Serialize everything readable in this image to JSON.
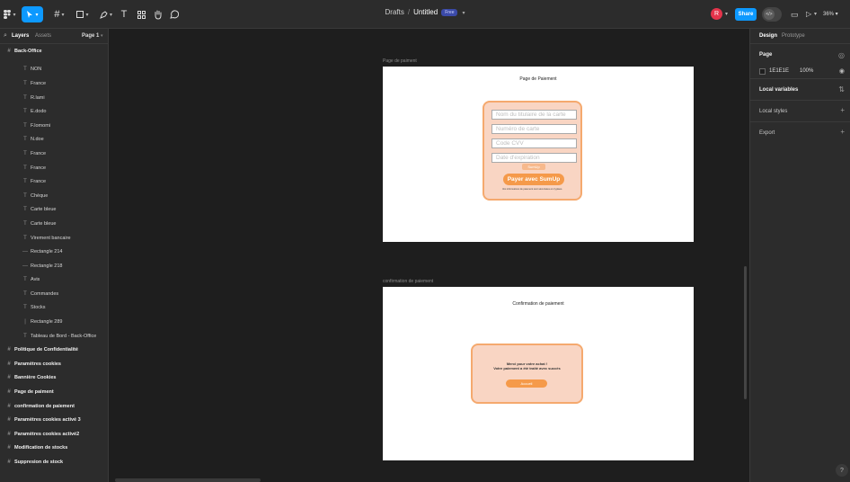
{
  "toolbar": {
    "tools": [
      {
        "name": "main-menu",
        "icon": "figma-logo-icon"
      },
      {
        "name": "move-tool",
        "icon": "cursor-icon"
      },
      {
        "name": "frame-tool",
        "icon": "hash-icon"
      },
      {
        "name": "shape-tool",
        "icon": "rectangle-icon"
      },
      {
        "name": "pen-tool",
        "icon": "pen-icon"
      },
      {
        "name": "text-tool",
        "icon": "text-icon",
        "glyph": "T"
      },
      {
        "name": "resources-tool",
        "icon": "resources-icon"
      },
      {
        "name": "hand-tool",
        "icon": "hand-icon"
      },
      {
        "name": "comment-tool",
        "icon": "comment-icon"
      }
    ],
    "accent": "#0d99ff"
  },
  "header": {
    "folder": "Drafts",
    "separator": "/",
    "file_name": "Untitled",
    "badge": "Free",
    "avatar_initial": "R",
    "share_label": "Share",
    "devmode_label": "</>",
    "zoom": "36%"
  },
  "left_panel": {
    "tab_layers": "Layers",
    "tab_assets": "Assets",
    "page_selector": "Page 1",
    "layers": [
      {
        "kind": "top",
        "label": "Back-Office",
        "icon": "frame-icon",
        "glyph": "#"
      },
      {
        "kind": "partial",
        "label": "NON",
        "icon": "text-layer-icon",
        "glyph": "T"
      },
      {
        "kind": "child",
        "label": "NON",
        "icon": "text-layer-icon",
        "glyph": "T"
      },
      {
        "kind": "child",
        "label": "France",
        "icon": "text-layer-icon",
        "glyph": "T"
      },
      {
        "kind": "child",
        "label": "R.lami",
        "icon": "text-layer-icon",
        "glyph": "T"
      },
      {
        "kind": "child",
        "label": "E.dodo",
        "icon": "text-layer-icon",
        "glyph": "T"
      },
      {
        "kind": "child",
        "label": "F.lomomi",
        "icon": "text-layer-icon",
        "glyph": "T"
      },
      {
        "kind": "child",
        "label": "N.doe",
        "icon": "text-layer-icon",
        "glyph": "T"
      },
      {
        "kind": "child",
        "label": "France",
        "icon": "text-layer-icon",
        "glyph": "T"
      },
      {
        "kind": "child",
        "label": "France",
        "icon": "text-layer-icon",
        "glyph": "T"
      },
      {
        "kind": "child",
        "label": "France",
        "icon": "text-layer-icon",
        "glyph": "T"
      },
      {
        "kind": "child",
        "label": "Chèque",
        "icon": "text-layer-icon",
        "glyph": "T"
      },
      {
        "kind": "child",
        "label": "Carte bleue",
        "icon": "text-layer-icon",
        "glyph": "T"
      },
      {
        "kind": "child",
        "label": "Carte bleue",
        "icon": "text-layer-icon",
        "glyph": "T"
      },
      {
        "kind": "child",
        "label": "Virement bancaire",
        "icon": "text-layer-icon",
        "glyph": "T"
      },
      {
        "kind": "child",
        "label": "Rectangle 214",
        "icon": "line-icon",
        "glyph": "—"
      },
      {
        "kind": "child",
        "label": "Rectangle 218",
        "icon": "line-icon",
        "glyph": "—"
      },
      {
        "kind": "child",
        "label": "Avis",
        "icon": "text-layer-icon",
        "glyph": "T"
      },
      {
        "kind": "child",
        "label": "Commandes",
        "icon": "text-layer-icon",
        "glyph": "T"
      },
      {
        "kind": "child",
        "label": "Stocks",
        "icon": "text-layer-icon",
        "glyph": "T"
      },
      {
        "kind": "child",
        "label": "Rectangle 289",
        "icon": "vertical-line-icon",
        "glyph": "|"
      },
      {
        "kind": "child",
        "label": "Tableau de Bord - Back-Office",
        "icon": "text-layer-icon",
        "glyph": "T"
      },
      {
        "kind": "top",
        "label": "Politique de Confidentialité",
        "icon": "frame-icon",
        "glyph": "#"
      },
      {
        "kind": "top",
        "label": "Paramètres cookies",
        "icon": "frame-icon",
        "glyph": "#"
      },
      {
        "kind": "top",
        "label": "Bannière Cookies",
        "icon": "frame-icon",
        "glyph": "#"
      },
      {
        "kind": "top",
        "label": "Page de paiment",
        "icon": "frame-icon",
        "glyph": "#"
      },
      {
        "kind": "top",
        "label": "confirmation de paiement",
        "icon": "frame-icon",
        "glyph": "#"
      },
      {
        "kind": "top",
        "label": "Paramètres cookies activé 3",
        "icon": "frame-icon",
        "glyph": "#"
      },
      {
        "kind": "top",
        "label": "Paramètres cookies activé2",
        "icon": "frame-icon",
        "glyph": "#"
      },
      {
        "kind": "top",
        "label": "Modification de stocks",
        "icon": "frame-icon",
        "glyph": "#"
      },
      {
        "kind": "top",
        "label": "Suppresion de stock",
        "icon": "frame-icon",
        "glyph": "#"
      }
    ]
  },
  "right_panel": {
    "tab_design": "Design",
    "tab_prototype": "Prototype",
    "page_heading": "Page",
    "background_hex": "1E1E1E",
    "background_opacity": "100%",
    "local_variables": "Local variables",
    "local_styles": "Local styles",
    "export": "Export",
    "help": "?"
  },
  "canvas": {
    "frame1": {
      "label": "Page de paiment",
      "title": "Page de Paiement",
      "fields": [
        "Nom du titulaire de la carte",
        "Numéro de carte",
        "Code CVV",
        "Date d'expiration"
      ],
      "logo": "SumUp",
      "button": "Payer avec SumUp",
      "note": "Vos informations de paiement sont sécurisées et cryptées."
    },
    "frame2": {
      "label": "confirmation de paiement",
      "title": "Confirmation de paiement",
      "line1": "Merci pour votre achat !",
      "line2": "Votre paiement a été traité avec succès",
      "button": "Accueil"
    },
    "colors": {
      "card": "#f9d5c3",
      "card_border": "#f5a96e",
      "button": "#f59a4a"
    }
  }
}
